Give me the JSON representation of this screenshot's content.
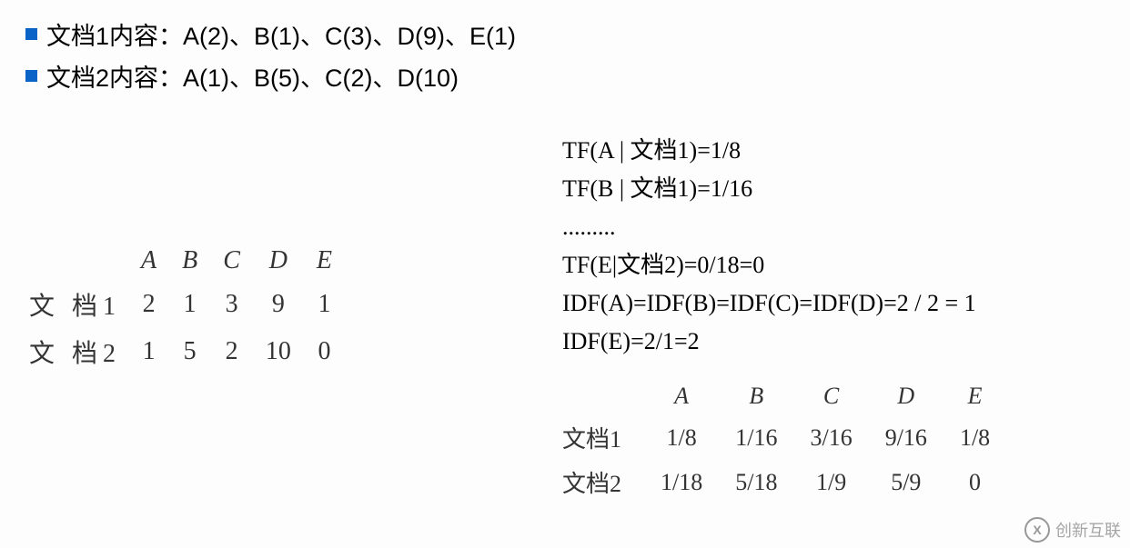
{
  "bullets": [
    "文档1内容：A(2)、B(1)、C(3)、D(9)、E(1)",
    "文档2内容：A(1)、B(5)、C(2)、D(10)"
  ],
  "count_table": {
    "headers": [
      "A",
      "B",
      "C",
      "D",
      "E"
    ],
    "rows": [
      {
        "label": "文 档1",
        "cells": [
          "2",
          "1",
          "3",
          "9",
          "1"
        ]
      },
      {
        "label": "文 档2",
        "cells": [
          "1",
          "5",
          "2",
          "10",
          "0"
        ]
      }
    ]
  },
  "formulas": [
    "TF(A | 文档1)=1/8",
    "TF(B | 文档1)=1/16",
    ".........",
    "TF(E|文档2)=0/18=0",
    "IDF(A)=IDF(B)=IDF(C)=IDF(D)=2 / 2 = 1",
    "IDF(E)=2/1=2"
  ],
  "tfidf_table": {
    "headers": [
      "A",
      "B",
      "C",
      "D",
      "E"
    ],
    "rows": [
      {
        "label": "文档1",
        "cells": [
          "1/8",
          "1/16",
          "3/16",
          "9/16",
          "1/8"
        ]
      },
      {
        "label": "文档2",
        "cells": [
          "1/18",
          "5/18",
          "1/9",
          "5/9",
          "0"
        ]
      }
    ]
  },
  "watermark": {
    "logo_letter": "X",
    "text": "创新互联"
  }
}
